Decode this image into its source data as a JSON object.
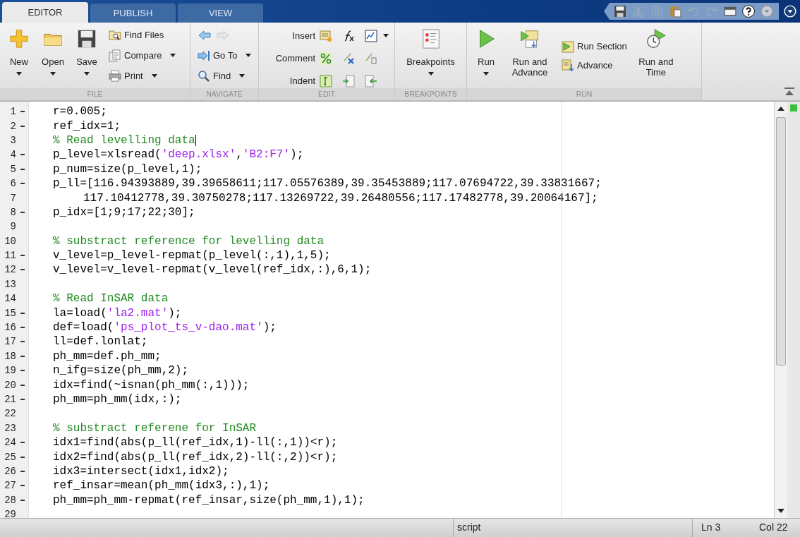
{
  "tabs": [
    {
      "label": "EDITOR",
      "selected": true
    },
    {
      "label": "PUBLISH",
      "selected": false
    },
    {
      "label": "VIEW",
      "selected": false
    }
  ],
  "ribbon": {
    "file": {
      "label": "FILE",
      "new": {
        "label": "New",
        "dropdown": true
      },
      "open": {
        "label": "Open",
        "dropdown": true
      },
      "save": {
        "label": "Save",
        "dropdown": true
      },
      "find_files": {
        "label": "Find Files",
        "dropdown": false
      },
      "compare": {
        "label": "Compare",
        "dropdown": true
      },
      "print": {
        "label": "Print",
        "dropdown": true
      }
    },
    "navigate": {
      "label": "NAVIGATE",
      "go_to": {
        "label": "Go To",
        "dropdown": true
      },
      "find": {
        "label": "Find",
        "dropdown": true
      }
    },
    "edit": {
      "label": "EDIT",
      "insert": "Insert",
      "comment": "Comment",
      "indent": "Indent"
    },
    "breakpoints": {
      "label": "BREAKPOINTS",
      "breakpoints": {
        "label": "Breakpoints",
        "dropdown": true
      }
    },
    "run": {
      "label": "RUN",
      "run": {
        "label": "Run",
        "dropdown": true
      },
      "run_and_advance": {
        "label": "Run and Advance",
        "dropdown": false
      },
      "run_section": "Run Section",
      "advance": "Advance",
      "run_and_time": {
        "label": "Run and Time",
        "dropdown": false
      }
    }
  },
  "lines": [
    {
      "number": "1",
      "executable": true,
      "continuation": false,
      "cursor": false,
      "tokens": [
        {
          "kind": "code",
          "text": "r=0.005;"
        }
      ]
    },
    {
      "number": "2",
      "executable": true,
      "continuation": false,
      "cursor": false,
      "tokens": [
        {
          "kind": "code",
          "text": "ref_idx=1;"
        }
      ]
    },
    {
      "number": "3",
      "executable": false,
      "continuation": false,
      "cursor": true,
      "tokens": [
        {
          "kind": "comment",
          "text": "% Read levelling data"
        }
      ]
    },
    {
      "number": "4",
      "executable": true,
      "continuation": false,
      "cursor": false,
      "tokens": [
        {
          "kind": "code",
          "text": "p_level=xlsread("
        },
        {
          "kind": "string",
          "text": "'deep.xlsx'"
        },
        {
          "kind": "code",
          "text": ","
        },
        {
          "kind": "string",
          "text": "'B2:F7'"
        },
        {
          "kind": "code",
          "text": ");"
        }
      ]
    },
    {
      "number": "5",
      "executable": true,
      "continuation": false,
      "cursor": false,
      "tokens": [
        {
          "kind": "code",
          "text": "p_num=size(p_level,1);"
        }
      ]
    },
    {
      "number": "6",
      "executable": true,
      "continuation": false,
      "cursor": false,
      "tokens": [
        {
          "kind": "code",
          "text": "p_ll=[116.94393889,39.39658611;117.05576389,39.35453889;117.07694722,39.33831667;"
        }
      ]
    },
    {
      "number": "7",
      "executable": false,
      "continuation": true,
      "cursor": false,
      "tokens": [
        {
          "kind": "code",
          "text": "117.10412778,39.30750278;117.13269722,39.26480556;117.17482778,39.20064167];"
        }
      ]
    },
    {
      "number": "8",
      "executable": true,
      "continuation": false,
      "cursor": false,
      "tokens": [
        {
          "kind": "code",
          "text": "p_idx=[1;9;17;22;30];"
        }
      ]
    },
    {
      "number": "9",
      "executable": false,
      "cursor": false
    },
    {
      "number": "10",
      "executable": false,
      "continuation": false,
      "cursor": false,
      "tokens": [
        {
          "kind": "comment",
          "text": "% substract reference for levelling data"
        }
      ]
    },
    {
      "number": "11",
      "executable": true,
      "continuation": false,
      "cursor": false,
      "tokens": [
        {
          "kind": "code",
          "text": "v_level=p_level-repmat(p_level(:,1),1,5);"
        }
      ]
    },
    {
      "number": "12",
      "executable": true,
      "continuation": false,
      "cursor": false,
      "tokens": [
        {
          "kind": "code",
          "text": "v_level=v_level-repmat(v_level(ref_idx,:),6,1);"
        }
      ]
    },
    {
      "number": "13",
      "executable": false,
      "cursor": false
    },
    {
      "number": "14",
      "executable": false,
      "continuation": false,
      "cursor": false,
      "tokens": [
        {
          "kind": "comment",
          "text": "% Read InSAR data"
        }
      ]
    },
    {
      "number": "15",
      "executable": true,
      "continuation": false,
      "cursor": false,
      "tokens": [
        {
          "kind": "code",
          "text": "la=load("
        },
        {
          "kind": "string",
          "text": "'la2.mat'"
        },
        {
          "kind": "code",
          "text": ");"
        }
      ]
    },
    {
      "number": "16",
      "executable": true,
      "continuation": false,
      "cursor": false,
      "tokens": [
        {
          "kind": "code",
          "text": "def=load("
        },
        {
          "kind": "string",
          "text": "'ps_plot_ts_v-dao.mat'"
        },
        {
          "kind": "code",
          "text": ");"
        }
      ]
    },
    {
      "number": "17",
      "executable": true,
      "continuation": false,
      "cursor": false,
      "tokens": [
        {
          "kind": "code",
          "text": "ll=def.lonlat;"
        }
      ]
    },
    {
      "number": "18",
      "executable": true,
      "continuation": false,
      "cursor": false,
      "tokens": [
        {
          "kind": "code",
          "text": "ph_mm=def.ph_mm;"
        }
      ]
    },
    {
      "number": "19",
      "executable": true,
      "continuation": false,
      "cursor": false,
      "tokens": [
        {
          "kind": "code",
          "text": "n_ifg=size(ph_mm,2);"
        }
      ]
    },
    {
      "number": "20",
      "executable": true,
      "continuation": false,
      "cursor": false,
      "tokens": [
        {
          "kind": "code",
          "text": "idx=find(~isnan(ph_mm(:,1)));"
        }
      ]
    },
    {
      "number": "21",
      "executable": true,
      "continuation": false,
      "cursor": false,
      "tokens": [
        {
          "kind": "code",
          "text": "ph_mm=ph_mm(idx,:);"
        }
      ]
    },
    {
      "number": "22",
      "executable": false,
      "cursor": false
    },
    {
      "number": "23",
      "executable": false,
      "continuation": false,
      "cursor": false,
      "tokens": [
        {
          "kind": "comment",
          "text": "% substract referene for InSAR"
        }
      ]
    },
    {
      "number": "24",
      "executable": true,
      "continuation": false,
      "cursor": false,
      "tokens": [
        {
          "kind": "code",
          "text": "idx1=find(abs(p_ll(ref_idx,1)-ll(:,1))<r);"
        }
      ]
    },
    {
      "number": "25",
      "executable": true,
      "continuation": false,
      "cursor": false,
      "tokens": [
        {
          "kind": "code",
          "text": "idx2=find(abs(p_ll(ref_idx,2)-ll(:,2))<r);"
        }
      ]
    },
    {
      "number": "26",
      "executable": true,
      "continuation": false,
      "cursor": false,
      "tokens": [
        {
          "kind": "code",
          "text": "idx3=intersect(idx1,idx2);"
        }
      ]
    },
    {
      "number": "27",
      "executable": true,
      "continuation": false,
      "cursor": false,
      "tokens": [
        {
          "kind": "code",
          "text": "ref_insar=mean(ph_mm(idx3,:),1);"
        }
      ]
    },
    {
      "number": "28",
      "executable": true,
      "continuation": false,
      "cursor": false,
      "tokens": [
        {
          "kind": "code",
          "text": "ph_mm=ph_mm-repmat(ref_insar,size(ph_mm,1),1);"
        }
      ]
    },
    {
      "number": "29",
      "executable": false,
      "cursor": false
    }
  ],
  "status_bar": {
    "file_type": "script",
    "line": "Ln 3",
    "column": "Col 22"
  }
}
